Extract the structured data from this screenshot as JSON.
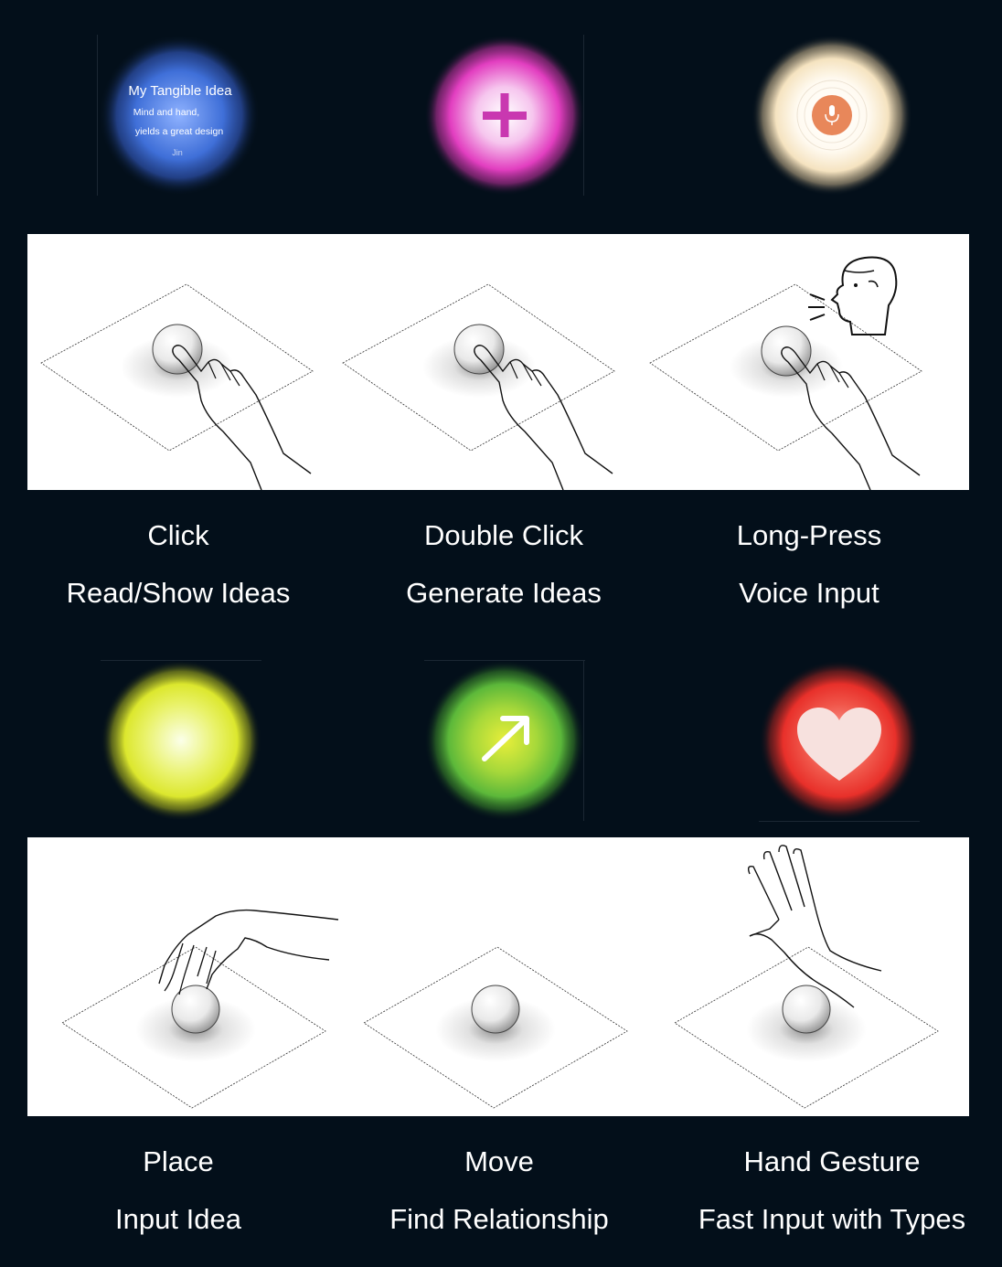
{
  "row1": {
    "orbs": [
      {
        "id": "idea-orb",
        "color": "#3f6fd8",
        "icon": "text-card-icon",
        "text": {
          "title": "My Tangible Idea",
          "line1": "Mind and hand,",
          "line2": "yields a great design",
          "author": "Jin"
        }
      },
      {
        "id": "generate-orb",
        "color": "#e23ec0",
        "icon": "plus-icon"
      },
      {
        "id": "voice-orb",
        "color": "#f5e3c0",
        "accent": "#e8875a",
        "icon": "microphone-icon"
      }
    ],
    "captions": [
      {
        "action": "Click",
        "result": "Read/Show Ideas"
      },
      {
        "action": "Double Click",
        "result": "Generate Ideas"
      },
      {
        "action": "Long-Press",
        "result": "Voice Input"
      }
    ]
  },
  "row2": {
    "orbs": [
      {
        "id": "input-orb",
        "color": "#e3ef3a",
        "icon": "none"
      },
      {
        "id": "relationship-orb",
        "color": "#6cc23a",
        "icon": "arrow-up-right-icon"
      },
      {
        "id": "gesture-orb",
        "color": "#e8302a",
        "icon": "heart-icon"
      }
    ],
    "captions": [
      {
        "action": "Place",
        "result": "Input Idea"
      },
      {
        "action": "Move",
        "result": "Find Relationship"
      },
      {
        "action": "Hand Gesture",
        "result": "Fast Input with Types"
      }
    ]
  },
  "colors": {
    "background": "#030f1a",
    "panel": "#ffffff",
    "caption": "#ffffff"
  }
}
